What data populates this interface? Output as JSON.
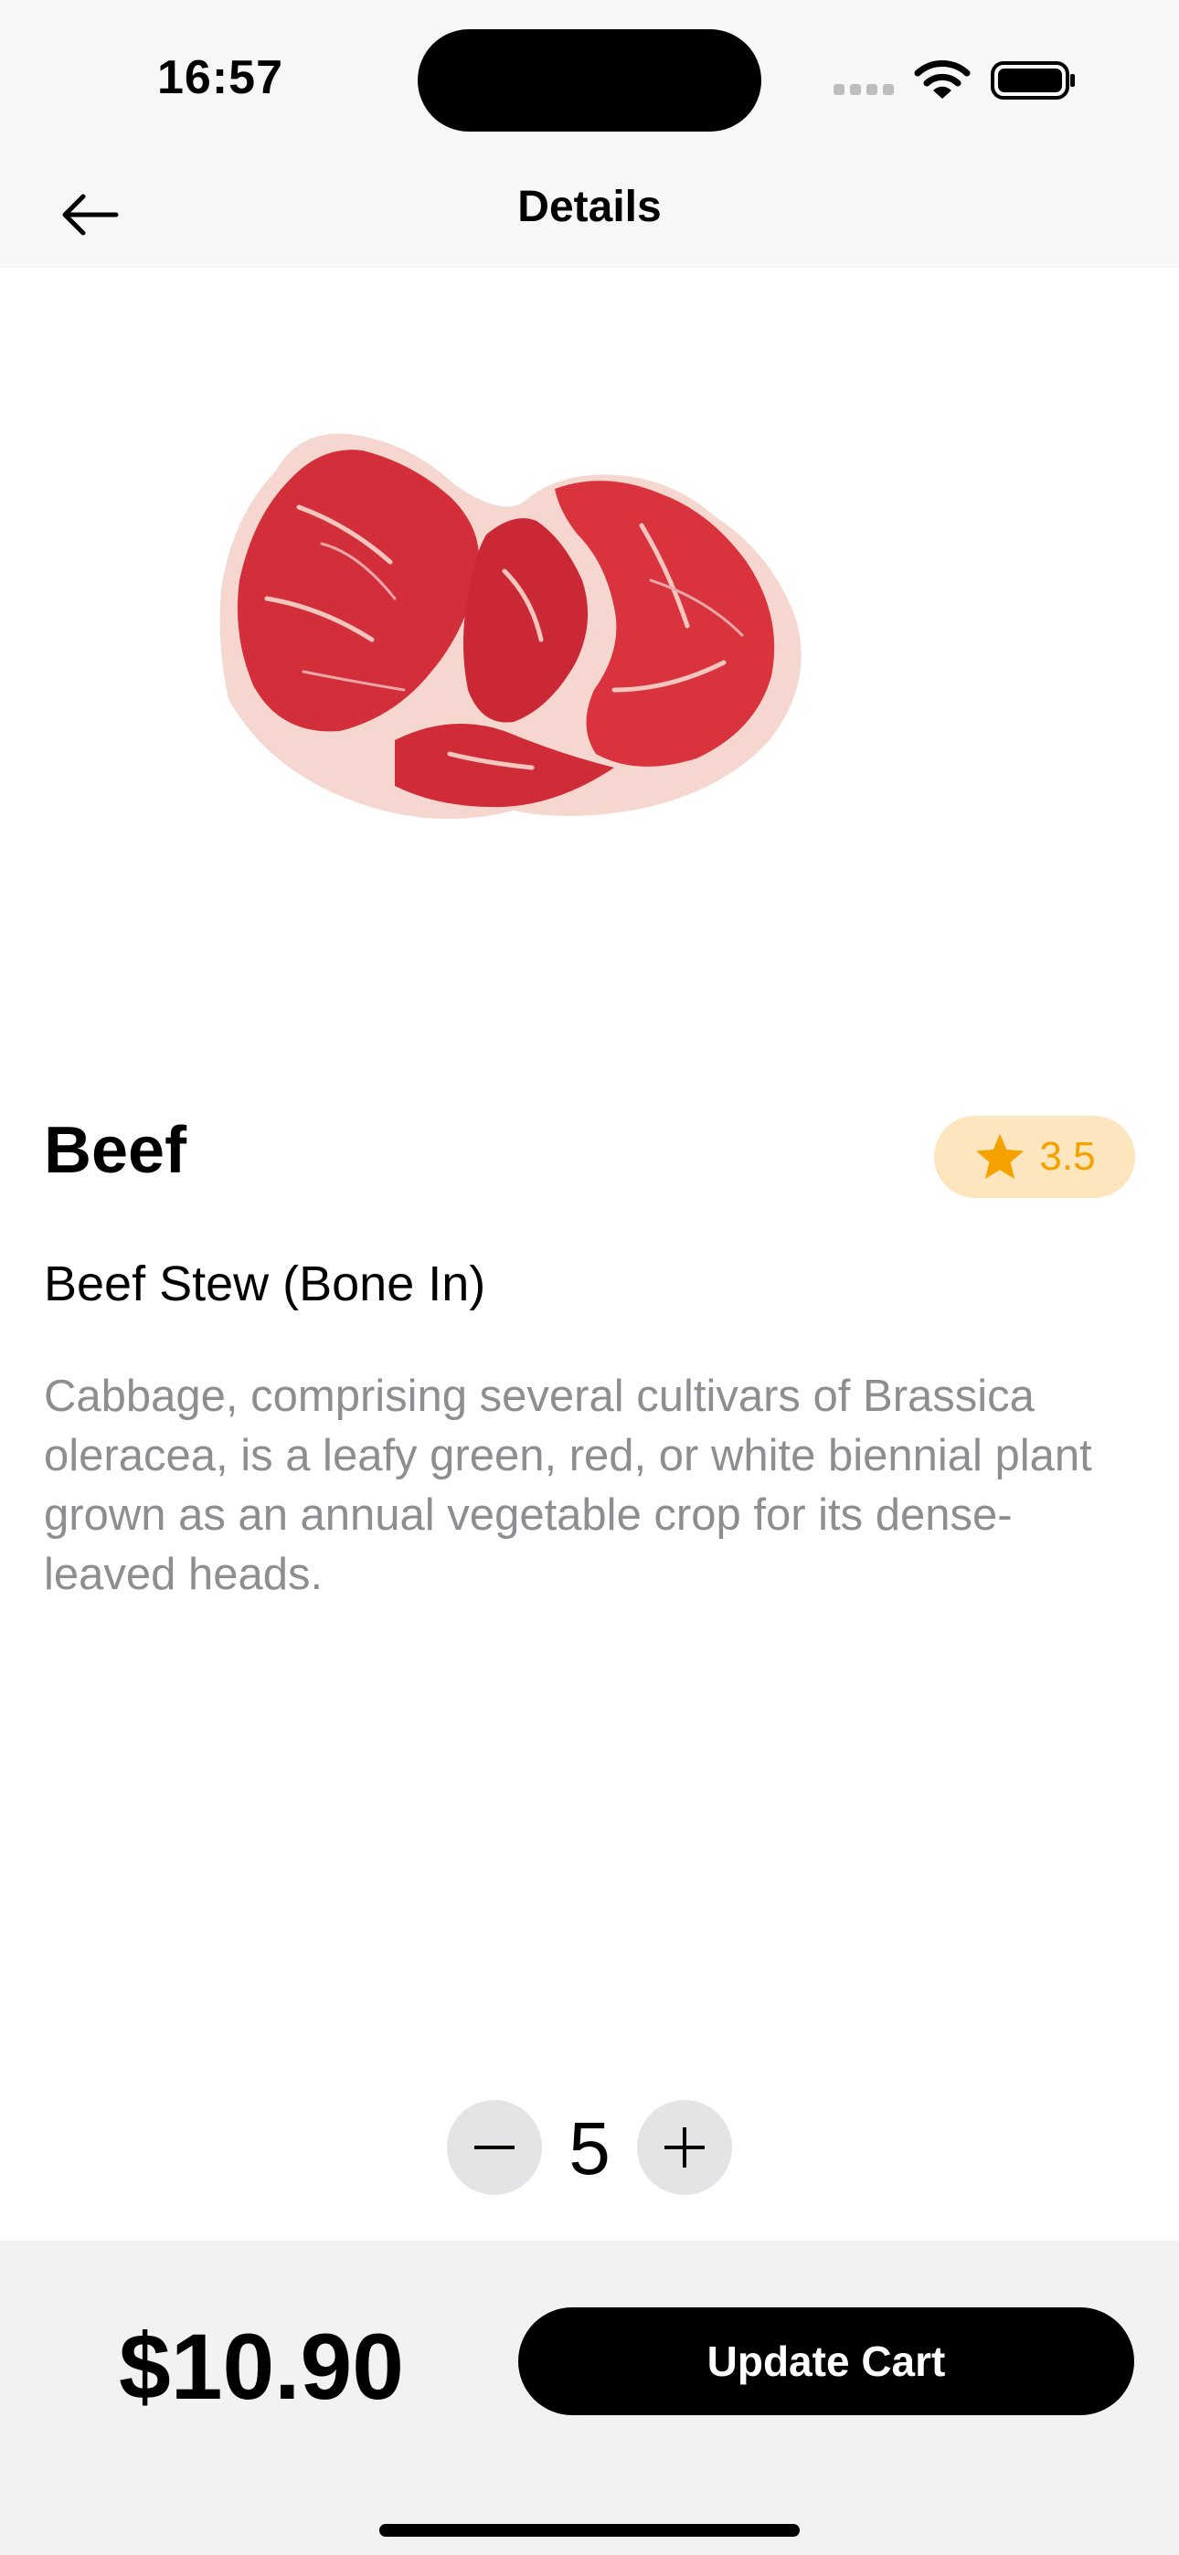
{
  "status_bar": {
    "time": "16:57",
    "icons": [
      "cellular-signal-icon",
      "wifi-icon",
      "battery-icon"
    ]
  },
  "nav": {
    "title": "Details",
    "back_icon": "arrow-left-icon"
  },
  "product": {
    "image": "beef-steak-image",
    "name": "Beef",
    "rating": "3.5",
    "rating_icon": "star-icon",
    "subtitle": "Beef Stew (Bone In)",
    "description": "Cabbage, comprising several cultivars of Brassica oleracea, is a leafy green, red, or white biennial plant grown as an annual vegetable crop for its dense-leaved heads."
  },
  "quantity": {
    "value": "5",
    "decrement_icon": "minus-icon",
    "increment_icon": "plus-icon"
  },
  "checkout": {
    "price": "$10.90",
    "button_label": "Update Cart"
  },
  "colors": {
    "accent": "#f5a100",
    "rating_background": "#fde5bd",
    "button": "#000000",
    "secondary_text": "#8d8d92"
  }
}
